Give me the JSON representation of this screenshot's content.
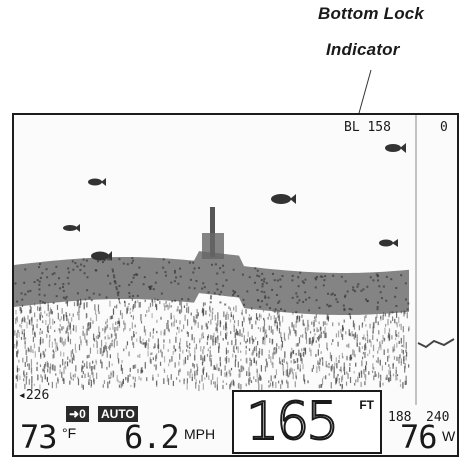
{
  "callout": {
    "line1": "Bottom Lock",
    "line2": "Indicator"
  },
  "display": {
    "bottom_lock": "BL 158",
    "scale_top": "0",
    "temperature": {
      "value": "73",
      "unit": "°F"
    },
    "speed": {
      "value": "6.2",
      "unit": "MPH"
    },
    "depth": {
      "value": "165",
      "unit": "FT"
    },
    "side_reading": "226",
    "lower_range": "188",
    "range_bottom": "240",
    "zoom_percent": {
      "value": "76",
      "unit": "W"
    },
    "badges": {
      "zero": "0",
      "auto": "AUTO"
    }
  },
  "icons": [
    "fish-icon",
    "left-arrow-icon",
    "arrow-right-icon"
  ]
}
